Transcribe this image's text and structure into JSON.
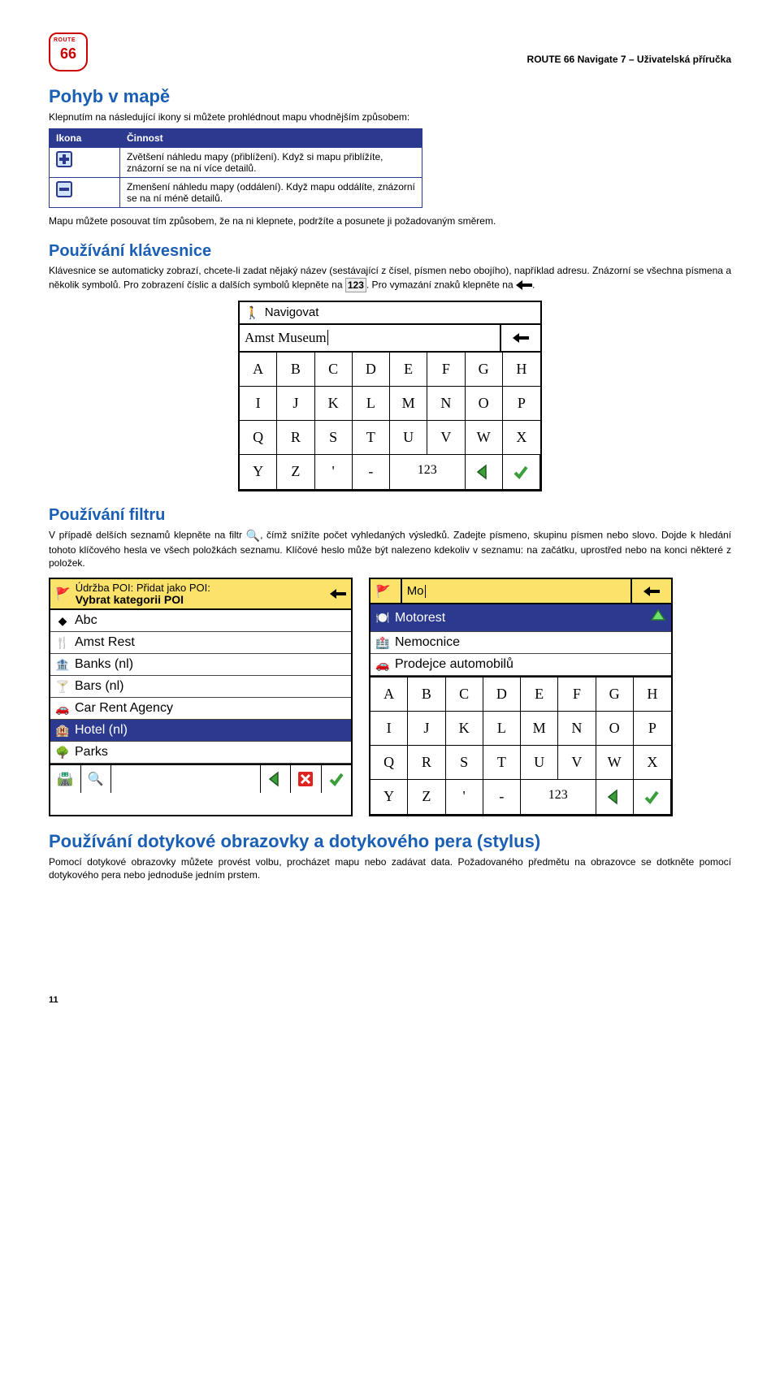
{
  "doc_header": "ROUTE 66 Navigate 7 – Uživatelská příručka",
  "sections": {
    "map_move": {
      "title": "Pohyb v mapě",
      "intro": "Klepnutím na následující ikony si můžete prohlédnout mapu vhodnějším způsobem:",
      "table": {
        "col_icon": "Ikona",
        "col_action": "Činnost",
        "row1": "Zvětšení náhledu mapy (přiblížení). Když si mapu přiblížíte, znázorní se na ní více detailů.",
        "row2": "Zmenšení náhledu mapy (oddálení). Když mapu oddálíte, znázorní se na ní méně detailů."
      },
      "note": "Mapu můžete posouvat tím způsobem, že na ni klepnete, podržíte a posunete ji požadovaným směrem."
    },
    "keyboard": {
      "title": "Používání klávesnice",
      "para1a": "Klávesnice se automaticky zobrazí, chcete-li zadat nějaký název (sestávající z čísel, písmen nebo obojího), například adresu. Znázorní se všechna písmena a několik symbolů. Pro zobrazení číslic a dalších symbolů klepněte na ",
      "para1b": ". Pro vymazání znaků klepněte na ",
      "para1c": "."
    },
    "filter": {
      "title": "Používání filtru",
      "para_a": "V případě delších seznamů klepněte na filtr ",
      "para_b": ", čímž snížíte počet vyhledaných výsledků. Zadejte písmeno, skupinu písmen nebo slovo. Dojde k hledání tohoto klíčového hesla ve všech položkách seznamu. Klíčové heslo může být nalezeno kdekoliv v seznamu: na začátku, uprostřed nebo na konci některé z položek."
    },
    "touch": {
      "title": "Používání dotykové obrazovky a dotykového pera (stylus)",
      "para": "Pomocí dotykové obrazovky můžete provést volbu, procházet mapu nebo zadávat data. Požadovaného předmětu na obrazovce se dotkněte pomocí dotykového pera nebo jednoduše jedním prstem."
    }
  },
  "inline": {
    "num123": "123"
  },
  "screenshots": {
    "kbd": {
      "title": "Navigovat",
      "input": "Amst Museum",
      "keys": [
        "A",
        "B",
        "C",
        "D",
        "E",
        "F",
        "G",
        "H",
        "I",
        "J",
        "K",
        "L",
        "M",
        "N",
        "O",
        "P",
        "Q",
        "R",
        "S",
        "T",
        "U",
        "V",
        "W",
        "X",
        "Y",
        "Z",
        "'",
        "-"
      ],
      "numlabel": "123"
    },
    "poi_list": {
      "title": "Údržba POI: Přidat jako POI:",
      "subtitle": "Vybrat kategorii POI",
      "items": [
        "Abc",
        "Amst Rest",
        "Banks (nl)",
        "Bars (nl)",
        "Car Rent Agency",
        "Hotel (nl)",
        "Parks"
      ],
      "selected_index": 5
    },
    "filter_kbd": {
      "input": "Mo",
      "items": [
        "Motorest",
        "Nemocnice",
        "Prodejce automobilů"
      ],
      "selected_index": 0,
      "keys": [
        "A",
        "B",
        "C",
        "D",
        "E",
        "F",
        "G",
        "H",
        "I",
        "J",
        "K",
        "L",
        "M",
        "N",
        "O",
        "P",
        "Q",
        "R",
        "S",
        "T",
        "U",
        "V",
        "W",
        "X",
        "Y",
        "Z",
        "'",
        "-"
      ],
      "numlabel": "123"
    }
  },
  "page_number": "11"
}
